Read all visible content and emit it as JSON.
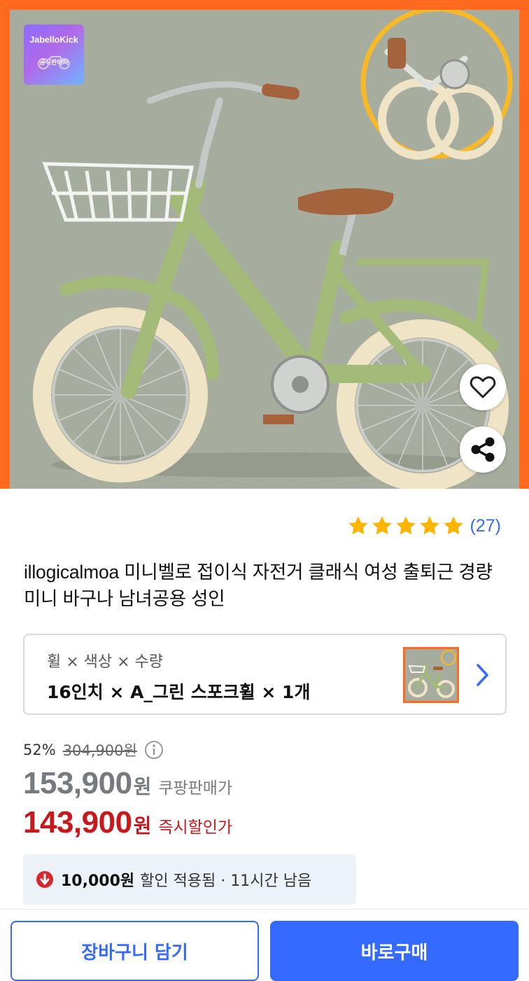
{
  "hero": {
    "brand_name": "JabelloKick",
    "brand_sub": "공식판매처",
    "frame_color": "#ff6a1f",
    "background_color": "#a7ad9e",
    "bike_color": "#a3ba78",
    "actions": {
      "like_icon": "heart-icon",
      "share_icon": "share-icon"
    }
  },
  "rating": {
    "stars": 5,
    "review_count": "(27)",
    "star_color": "#ffb400"
  },
  "product": {
    "title": "illogicalmoa 미니벨로 접이식 자전거 클래식 여성 출퇴근 경량 미니 바구나 남녀공용 성인"
  },
  "option": {
    "label": "휠 × 색상 × 수량",
    "value": "16인치 × A_그린 스포크휠 × 1개"
  },
  "price": {
    "discount_rate": "52%",
    "original": "304,900원",
    "coupang_price": "153,900",
    "coupang_unit": "원",
    "coupang_label": "쿠팡판매가",
    "instant_price": "143,900",
    "instant_unit": "원",
    "instant_label": "즉시할인가",
    "accent_red": "#c7191d"
  },
  "coupon": {
    "amount": "10,000원",
    "text": "할인 적용됨 · 11시간 남음"
  },
  "buttons": {
    "cart": "장바구니 담기",
    "buy": "바로구매",
    "primary_color": "#346aff"
  }
}
